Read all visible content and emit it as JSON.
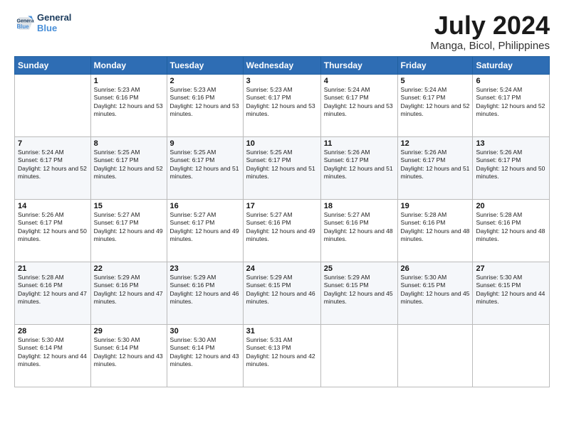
{
  "header": {
    "logo_line1": "General",
    "logo_line2": "Blue",
    "month": "July 2024",
    "location": "Manga, Bicol, Philippines"
  },
  "weekdays": [
    "Sunday",
    "Monday",
    "Tuesday",
    "Wednesday",
    "Thursday",
    "Friday",
    "Saturday"
  ],
  "weeks": [
    [
      {
        "day": "",
        "sunrise": "",
        "sunset": "",
        "daylight": ""
      },
      {
        "day": "1",
        "sunrise": "Sunrise: 5:23 AM",
        "sunset": "Sunset: 6:16 PM",
        "daylight": "Daylight: 12 hours and 53 minutes."
      },
      {
        "day": "2",
        "sunrise": "Sunrise: 5:23 AM",
        "sunset": "Sunset: 6:16 PM",
        "daylight": "Daylight: 12 hours and 53 minutes."
      },
      {
        "day": "3",
        "sunrise": "Sunrise: 5:23 AM",
        "sunset": "Sunset: 6:17 PM",
        "daylight": "Daylight: 12 hours and 53 minutes."
      },
      {
        "day": "4",
        "sunrise": "Sunrise: 5:24 AM",
        "sunset": "Sunset: 6:17 PM",
        "daylight": "Daylight: 12 hours and 53 minutes."
      },
      {
        "day": "5",
        "sunrise": "Sunrise: 5:24 AM",
        "sunset": "Sunset: 6:17 PM",
        "daylight": "Daylight: 12 hours and 52 minutes."
      },
      {
        "day": "6",
        "sunrise": "Sunrise: 5:24 AM",
        "sunset": "Sunset: 6:17 PM",
        "daylight": "Daylight: 12 hours and 52 minutes."
      }
    ],
    [
      {
        "day": "7",
        "sunrise": "Sunrise: 5:24 AM",
        "sunset": "Sunset: 6:17 PM",
        "daylight": "Daylight: 12 hours and 52 minutes."
      },
      {
        "day": "8",
        "sunrise": "Sunrise: 5:25 AM",
        "sunset": "Sunset: 6:17 PM",
        "daylight": "Daylight: 12 hours and 52 minutes."
      },
      {
        "day": "9",
        "sunrise": "Sunrise: 5:25 AM",
        "sunset": "Sunset: 6:17 PM",
        "daylight": "Daylight: 12 hours and 51 minutes."
      },
      {
        "day": "10",
        "sunrise": "Sunrise: 5:25 AM",
        "sunset": "Sunset: 6:17 PM",
        "daylight": "Daylight: 12 hours and 51 minutes."
      },
      {
        "day": "11",
        "sunrise": "Sunrise: 5:26 AM",
        "sunset": "Sunset: 6:17 PM",
        "daylight": "Daylight: 12 hours and 51 minutes."
      },
      {
        "day": "12",
        "sunrise": "Sunrise: 5:26 AM",
        "sunset": "Sunset: 6:17 PM",
        "daylight": "Daylight: 12 hours and 51 minutes."
      },
      {
        "day": "13",
        "sunrise": "Sunrise: 5:26 AM",
        "sunset": "Sunset: 6:17 PM",
        "daylight": "Daylight: 12 hours and 50 minutes."
      }
    ],
    [
      {
        "day": "14",
        "sunrise": "Sunrise: 5:26 AM",
        "sunset": "Sunset: 6:17 PM",
        "daylight": "Daylight: 12 hours and 50 minutes."
      },
      {
        "day": "15",
        "sunrise": "Sunrise: 5:27 AM",
        "sunset": "Sunset: 6:17 PM",
        "daylight": "Daylight: 12 hours and 49 minutes."
      },
      {
        "day": "16",
        "sunrise": "Sunrise: 5:27 AM",
        "sunset": "Sunset: 6:17 PM",
        "daylight": "Daylight: 12 hours and 49 minutes."
      },
      {
        "day": "17",
        "sunrise": "Sunrise: 5:27 AM",
        "sunset": "Sunset: 6:16 PM",
        "daylight": "Daylight: 12 hours and 49 minutes."
      },
      {
        "day": "18",
        "sunrise": "Sunrise: 5:27 AM",
        "sunset": "Sunset: 6:16 PM",
        "daylight": "Daylight: 12 hours and 48 minutes."
      },
      {
        "day": "19",
        "sunrise": "Sunrise: 5:28 AM",
        "sunset": "Sunset: 6:16 PM",
        "daylight": "Daylight: 12 hours and 48 minutes."
      },
      {
        "day": "20",
        "sunrise": "Sunrise: 5:28 AM",
        "sunset": "Sunset: 6:16 PM",
        "daylight": "Daylight: 12 hours and 48 minutes."
      }
    ],
    [
      {
        "day": "21",
        "sunrise": "Sunrise: 5:28 AM",
        "sunset": "Sunset: 6:16 PM",
        "daylight": "Daylight: 12 hours and 47 minutes."
      },
      {
        "day": "22",
        "sunrise": "Sunrise: 5:29 AM",
        "sunset": "Sunset: 6:16 PM",
        "daylight": "Daylight: 12 hours and 47 minutes."
      },
      {
        "day": "23",
        "sunrise": "Sunrise: 5:29 AM",
        "sunset": "Sunset: 6:16 PM",
        "daylight": "Daylight: 12 hours and 46 minutes."
      },
      {
        "day": "24",
        "sunrise": "Sunrise: 5:29 AM",
        "sunset": "Sunset: 6:15 PM",
        "daylight": "Daylight: 12 hours and 46 minutes."
      },
      {
        "day": "25",
        "sunrise": "Sunrise: 5:29 AM",
        "sunset": "Sunset: 6:15 PM",
        "daylight": "Daylight: 12 hours and 45 minutes."
      },
      {
        "day": "26",
        "sunrise": "Sunrise: 5:30 AM",
        "sunset": "Sunset: 6:15 PM",
        "daylight": "Daylight: 12 hours and 45 minutes."
      },
      {
        "day": "27",
        "sunrise": "Sunrise: 5:30 AM",
        "sunset": "Sunset: 6:15 PM",
        "daylight": "Daylight: 12 hours and 44 minutes."
      }
    ],
    [
      {
        "day": "28",
        "sunrise": "Sunrise: 5:30 AM",
        "sunset": "Sunset: 6:14 PM",
        "daylight": "Daylight: 12 hours and 44 minutes."
      },
      {
        "day": "29",
        "sunrise": "Sunrise: 5:30 AM",
        "sunset": "Sunset: 6:14 PM",
        "daylight": "Daylight: 12 hours and 43 minutes."
      },
      {
        "day": "30",
        "sunrise": "Sunrise: 5:30 AM",
        "sunset": "Sunset: 6:14 PM",
        "daylight": "Daylight: 12 hours and 43 minutes."
      },
      {
        "day": "31",
        "sunrise": "Sunrise: 5:31 AM",
        "sunset": "Sunset: 6:13 PM",
        "daylight": "Daylight: 12 hours and 42 minutes."
      },
      {
        "day": "",
        "sunrise": "",
        "sunset": "",
        "daylight": ""
      },
      {
        "day": "",
        "sunrise": "",
        "sunset": "",
        "daylight": ""
      },
      {
        "day": "",
        "sunrise": "",
        "sunset": "",
        "daylight": ""
      }
    ]
  ]
}
